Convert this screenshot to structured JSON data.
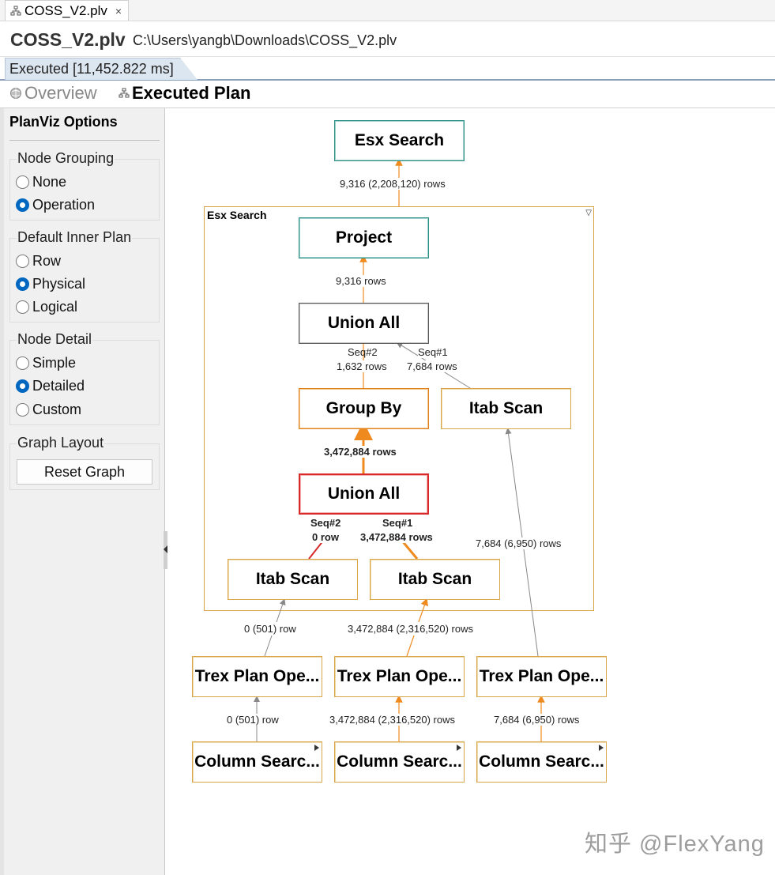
{
  "file_tab": {
    "label": "COSS_V2.plv",
    "close": "×",
    "icon": "plan-file-icon"
  },
  "header": {
    "title": "COSS_V2.plv",
    "path": "C:\\Users\\yangb\\Downloads\\COSS_V2.plv"
  },
  "exec_tab": {
    "label": "Executed [11,452.822 ms]"
  },
  "view_tabs": [
    {
      "label": "Overview",
      "icon": "globe-icon",
      "active": false
    },
    {
      "label": "Executed Plan",
      "icon": "plan-tree-icon",
      "active": true
    }
  ],
  "sidebar": {
    "title": "PlanViz Options",
    "node_grouping": {
      "title": "Node Grouping",
      "options": [
        "None",
        "Operation"
      ],
      "selected": "Operation"
    },
    "default_inner_plan": {
      "title": "Default Inner Plan",
      "options": [
        "Row",
        "Physical",
        "Logical"
      ],
      "selected": "Physical"
    },
    "node_detail": {
      "title": "Node Detail",
      "options": [
        "Simple",
        "Detailed",
        "Custom"
      ],
      "selected": "Detailed"
    },
    "graph_layout": {
      "title": "Graph Layout",
      "button": "Reset Graph"
    }
  },
  "graph": {
    "cluster_title": "Esx Search",
    "nodes": {
      "esx_search": "Esx Search",
      "project": "Project",
      "union_all_top": "Union All",
      "group_by": "Group By",
      "itab_scan_right": "Itab Scan",
      "union_all_inner": "Union All",
      "itab_scan_left": "Itab Scan",
      "itab_scan_mid": "Itab Scan",
      "trex_1": "Trex Plan Ope...",
      "trex_2": "Trex Plan Ope...",
      "trex_3": "Trex Plan Ope...",
      "colsearch_1": "Column Searc...",
      "colsearch_2": "Column Searc...",
      "colsearch_3": "Column Searc..."
    },
    "edge_labels": {
      "esx_rows": "9,316 (2,208,120) rows",
      "project_rows": "9,316 rows",
      "seq2_top": "Seq#2",
      "rows_1632": "1,632 rows",
      "seq1_top": "Seq#1",
      "rows_7684": "7,684 rows",
      "groupby_rows": "3,472,884 rows",
      "seq2_inner": "Seq#2",
      "zero_row": "0 row",
      "seq1_inner": "Seq#1",
      "rows_3472884": "3,472,884 rows",
      "right_long": "7,684 (6,950) rows",
      "left_out": "0 (501) row",
      "mid_out": "3,472,884 (2,316,520) rows",
      "c1_rows": "0 (501) row",
      "c2_rows": "3,472,884 (2,316,520) rows",
      "c3_rows": "7,684 (6,950) rows"
    }
  },
  "watermark": "知乎 @FlexYang"
}
